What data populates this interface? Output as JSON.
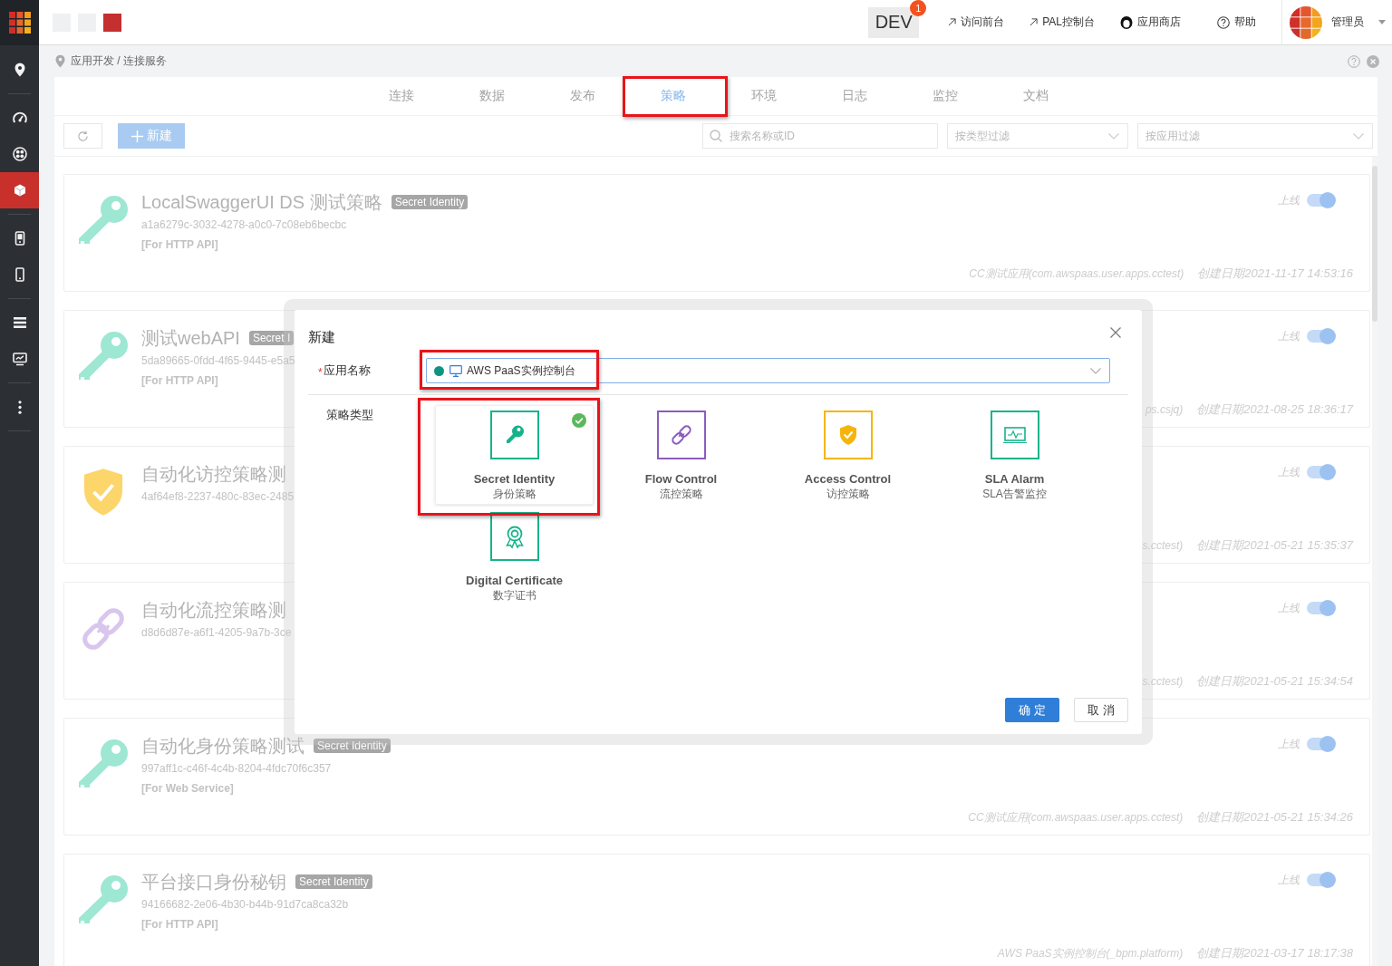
{
  "sidebar": {
    "groups": [
      {
        "items": [
          {
            "selected": false
          }
        ]
      },
      {
        "items": [
          {
            "selected": false
          },
          {
            "selected": false
          },
          {
            "selected": true
          }
        ]
      },
      {
        "items": [
          {
            "selected": false
          },
          {
            "selected": false
          }
        ]
      },
      {
        "items": [
          {
            "selected": false
          },
          {
            "selected": false
          }
        ]
      },
      {
        "items": [
          {
            "selected": false
          }
        ]
      }
    ]
  },
  "header": {
    "env": {
      "label": "DEV",
      "badge": "1"
    },
    "links": [
      {
        "kind": "external",
        "label": "访问前台"
      },
      {
        "kind": "external",
        "label": "PAL控制台"
      },
      {
        "kind": "store",
        "label": "应用商店"
      },
      {
        "kind": "help",
        "label": "帮助"
      }
    ],
    "user": {
      "name": "管理员"
    }
  },
  "breadcrumb": "应用开发 / 连接服务",
  "tabs": [
    {
      "label": "连接",
      "selected": false,
      "highlighted": false
    },
    {
      "label": "数据",
      "selected": false,
      "highlighted": false
    },
    {
      "label": "发布",
      "selected": false,
      "highlighted": false
    },
    {
      "label": "策略",
      "selected": true,
      "highlighted": true
    },
    {
      "label": "环境",
      "selected": false,
      "highlighted": false
    },
    {
      "label": "日志",
      "selected": false,
      "highlighted": false
    },
    {
      "label": "监控",
      "selected": false,
      "highlighted": false
    },
    {
      "label": "文档",
      "selected": false,
      "highlighted": false
    }
  ],
  "toolbar": {
    "new_button": "新建",
    "search": {
      "placeholder": "搜索名称或ID"
    },
    "type_filter": {
      "placeholder": "按类型过滤"
    },
    "app_filter": {
      "placeholder": "按应用过滤"
    }
  },
  "policies": [
    {
      "kind": "secret_identity",
      "title": "LocalSwaggerUI DS 测试策略",
      "tag": "Secret Identity",
      "id": "a1a6279c-3032-4278-a0c0-7c08eb6becbc",
      "scope": "[For HTTP API]",
      "status": "上线",
      "on": true,
      "app": "CC测试应用(com.awspaas.user.apps.cctest)",
      "created": "创建日期2021-11-17 14:53:16"
    },
    {
      "kind": "secret_identity",
      "title": "测试webAPI",
      "tag": "Secret I",
      "id": "5da89665-0fdd-4f65-9445-e5a5",
      "scope": "[For HTTP API]",
      "status": "上线",
      "on": true,
      "app": "ps.csjq)",
      "created": "创建日期2021-08-25 18:36:17"
    },
    {
      "kind": "access_control",
      "title": "自动化访控策略测",
      "id": "4af64ef8-2237-480c-83ec-2485",
      "status": "上线",
      "on": true,
      "app": "s.cctest)",
      "created": "创建日期2021-05-21 15:35:37"
    },
    {
      "kind": "flow_control",
      "title": "自动化流控策略测",
      "id": "d8d6d87e-a6f1-4205-9a7b-3ce",
      "status": "上线",
      "on": true,
      "app": "s.cctest)",
      "created": "创建日期2021-05-21 15:34:54"
    },
    {
      "kind": "secret_identity",
      "title": "自动化身份策略测试",
      "tag": "Secret Identity",
      "id": "997aff1c-c46f-4c4b-8204-4fdc70f6c357",
      "scope": "[For Web Service]",
      "status": "上线",
      "on": true,
      "app": "CC测试应用(com.awspaas.user.apps.cctest)",
      "created": "创建日期2021-05-21 15:34:26"
    },
    {
      "kind": "secret_identity",
      "title": "平台接口身份秘钥",
      "tag": "Secret Identity",
      "id": "94166682-2e06-4b30-b44b-91d7ca8ca32b",
      "scope": "[For HTTP API]",
      "status": "上线",
      "on": true,
      "app": "AWS PaaS实例控制台(_bpm.platform)",
      "created": "创建日期2021-03-17 18:17:38"
    }
  ],
  "dialog": {
    "title": "新建",
    "app_field": {
      "required_mark": "*",
      "label": "应用名称",
      "value": "AWS PaaS实例控制台",
      "highlighted": true
    },
    "type_label": "策略类型",
    "types": [
      {
        "kind": "secret_identity",
        "name": "Secret Identity",
        "subtitle": "身份策略",
        "selected": true,
        "highlighted": true
      },
      {
        "kind": "flow_control",
        "name": "Flow Control",
        "subtitle": "流控策略",
        "selected": false,
        "highlighted": false
      },
      {
        "kind": "access_control",
        "name": "Access Control",
        "subtitle": "访控策略",
        "selected": false,
        "highlighted": false
      },
      {
        "kind": "sla_alarm",
        "name": "SLA Alarm",
        "subtitle": "SLA告警监控",
        "selected": false,
        "highlighted": false
      },
      {
        "kind": "digital_certificate",
        "name": "Digital Certificate",
        "subtitle": "数字证书",
        "selected": false,
        "highlighted": false
      }
    ],
    "buttons": [
      {
        "kind": "primary",
        "label": "确 定"
      },
      {
        "kind": "default",
        "label": "取 消"
      }
    ]
  }
}
